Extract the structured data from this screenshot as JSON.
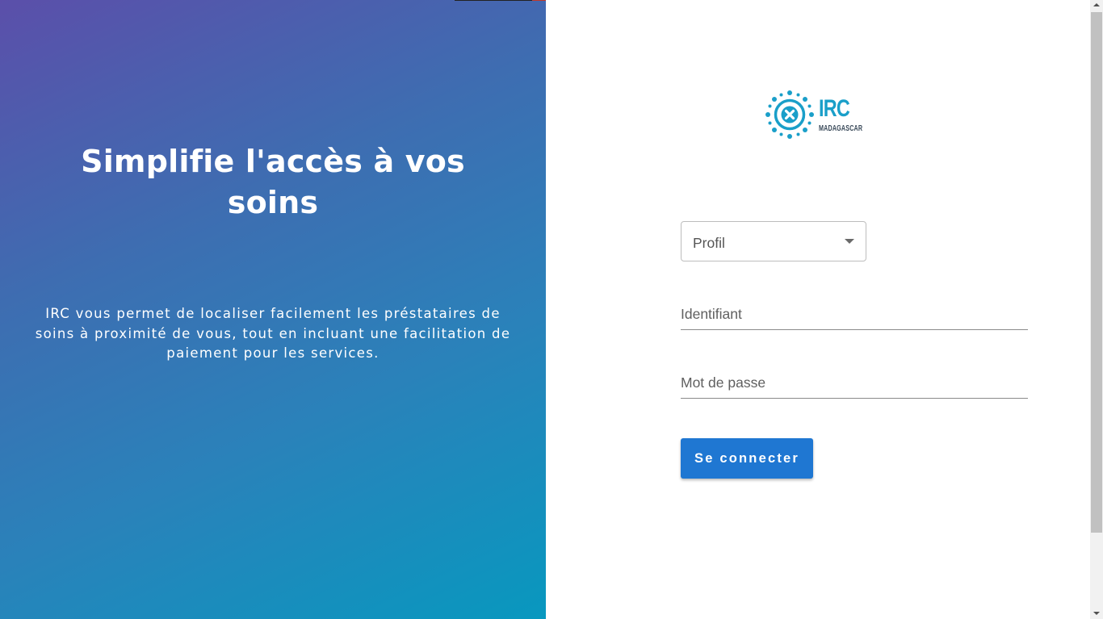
{
  "hero": {
    "title": "Simplifie l'accès à vos soins",
    "description": "IRC vous permet de localiser facilement les préstataires de soins à proximité de vous, tout en incluant une facilitation de paiement pour les services."
  },
  "brand": {
    "name": "IRC",
    "subtitle": "MADAGASCAR",
    "logo_icon": "virus-cross-icon",
    "color": "#1a9fc9"
  },
  "login": {
    "profile_select": {
      "label": "Profil",
      "icon": "caret-down-icon"
    },
    "identifier_field": {
      "placeholder": "Identifiant",
      "value": ""
    },
    "password_field": {
      "placeholder": "Mot de passe",
      "value": ""
    },
    "submit_label": "Se connecter"
  },
  "colors": {
    "accent": "#1f77d2",
    "gradient_start": "#5b4faa",
    "gradient_end": "#0898bf"
  }
}
